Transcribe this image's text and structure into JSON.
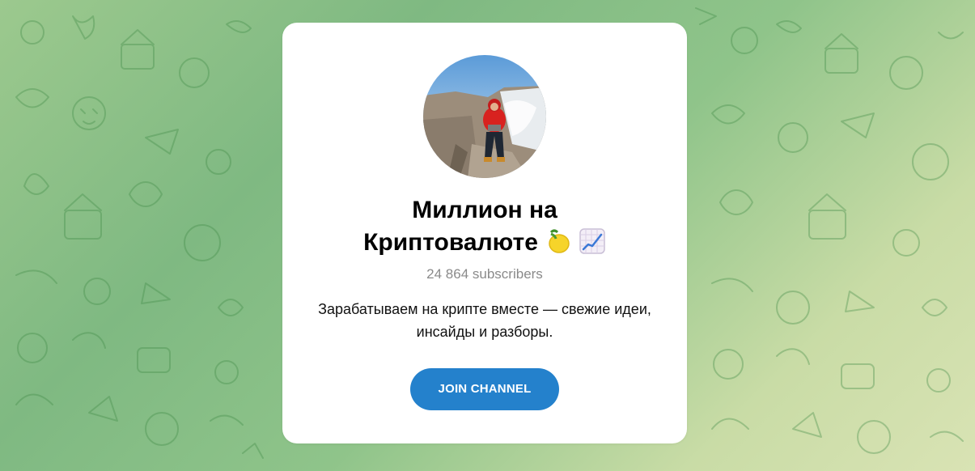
{
  "channel": {
    "title_line1": "Миллион на",
    "title_line2": "Криптовалюте",
    "title_emojis": [
      "lemon-icon",
      "chart-increasing-icon"
    ],
    "subscribers": "24 864 subscribers",
    "description_line1": "Зарабатываем на крипте вместе — свежие идеи,",
    "description_line2": "инсайды и разборы.",
    "join_label": "JOIN CHANNEL"
  },
  "colors": {
    "accent": "#2481cc",
    "background_green": "#8fc48a",
    "background_yellow": "#d9e3b4"
  }
}
